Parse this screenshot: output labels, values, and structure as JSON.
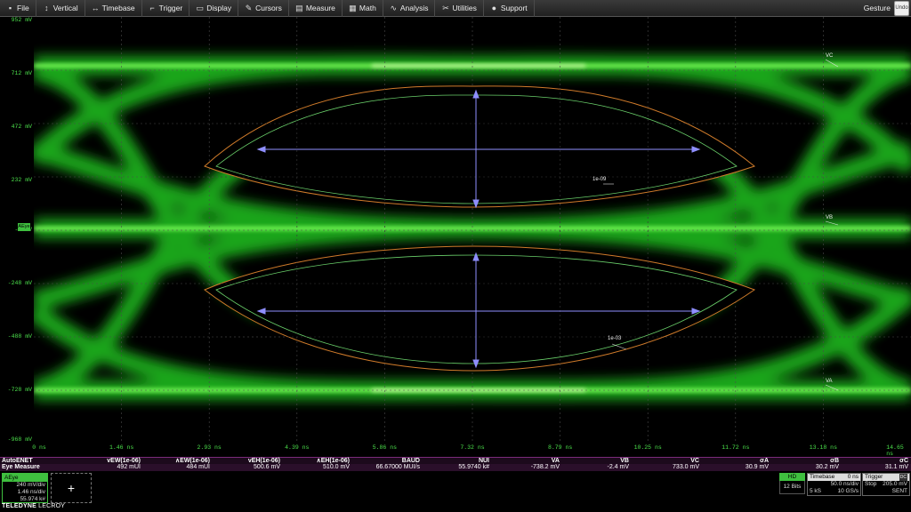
{
  "menu": {
    "items": [
      {
        "label": "File",
        "icon": "file-icon",
        "glyph": "▪"
      },
      {
        "label": "Vertical",
        "icon": "vertical-icon",
        "glyph": "↕"
      },
      {
        "label": "Timebase",
        "icon": "timebase-icon",
        "glyph": "↔"
      },
      {
        "label": "Trigger",
        "icon": "trigger-icon",
        "glyph": "⌐"
      },
      {
        "label": "Display",
        "icon": "display-icon",
        "glyph": "▭"
      },
      {
        "label": "Cursors",
        "icon": "cursors-icon",
        "glyph": "✎"
      },
      {
        "label": "Measure",
        "icon": "measure-icon",
        "glyph": "▤"
      },
      {
        "label": "Math",
        "icon": "math-icon",
        "glyph": "▦"
      },
      {
        "label": "Analysis",
        "icon": "analysis-icon",
        "glyph": "∿"
      },
      {
        "label": "Utilities",
        "icon": "utilities-icon",
        "glyph": "✂"
      },
      {
        "label": "Support",
        "icon": "support-icon",
        "glyph": "●"
      }
    ],
    "gesture_label": "Gesture",
    "undo_label": "Undo"
  },
  "grid": {
    "y_labels": [
      "952 mV",
      "712 mV",
      "472 mV",
      "232 mV",
      "-8 mV",
      "-248 mV",
      "-488 mV",
      "-728 mV",
      "-968 mV"
    ],
    "x_labels": [
      "0 ns",
      "1.46 ns",
      "2.93 ns",
      "4.39 ns",
      "5.86 ns",
      "7.32 ns",
      "8.79 ns",
      "10.25 ns",
      "11.72 ns",
      "13.18 ns",
      "14.65 ns"
    ],
    "channel_marker": "AEye",
    "level_tags": {
      "vc": "VC",
      "vb": "VB",
      "va": "VA"
    },
    "eye_tags": {
      "upper": "1e-09",
      "lower": "1e-03"
    },
    "trace_color": "#33ff33"
  },
  "measure": {
    "row1_title": "AutoENET",
    "row2_title": "Eye Measure",
    "columns": [
      {
        "header": "vEW(1e-06)",
        "value": "492 mUI"
      },
      {
        "header": "∧EW(1e-06)",
        "value": "484 mUI"
      },
      {
        "header": "vEH(1e-06)",
        "value": "500.6 mV"
      },
      {
        "header": "∧EH(1e-06)",
        "value": "510.0 mV"
      },
      {
        "header": "BAUD",
        "value": "66.67000 MUI/s"
      },
      {
        "header": "NUI",
        "value": "55.9740 k#"
      },
      {
        "header": "VA",
        "value": "-738.2 mV"
      },
      {
        "header": "VB",
        "value": "-2.4 mV"
      },
      {
        "header": "VC",
        "value": "733.0 mV"
      },
      {
        "header": "σA",
        "value": "30.9 mV"
      },
      {
        "header": "σB",
        "value": "30.2 mV"
      },
      {
        "header": "σC",
        "value": "31.1 mV"
      }
    ]
  },
  "channel_desc": {
    "name": "AEye",
    "vdiv": "240 mV/div",
    "tdiv": "1.46 ns/div",
    "count": "55.974 k#"
  },
  "add_label": "+",
  "acq": {
    "hd_label": "HD",
    "bits": "12 Bits"
  },
  "timebase": {
    "title": "Timebase",
    "delay": "0 ns",
    "tdiv": "50.0 ns/div",
    "samples": "5 kS",
    "rate": "10 GS/s"
  },
  "trigger": {
    "title": "Trigger",
    "badge": "DC",
    "mode": "Stop",
    "level": "205.0 mV",
    "type": "SENT"
  },
  "brand": {
    "name": "TELEDYNE",
    "sub": "LECROY"
  }
}
